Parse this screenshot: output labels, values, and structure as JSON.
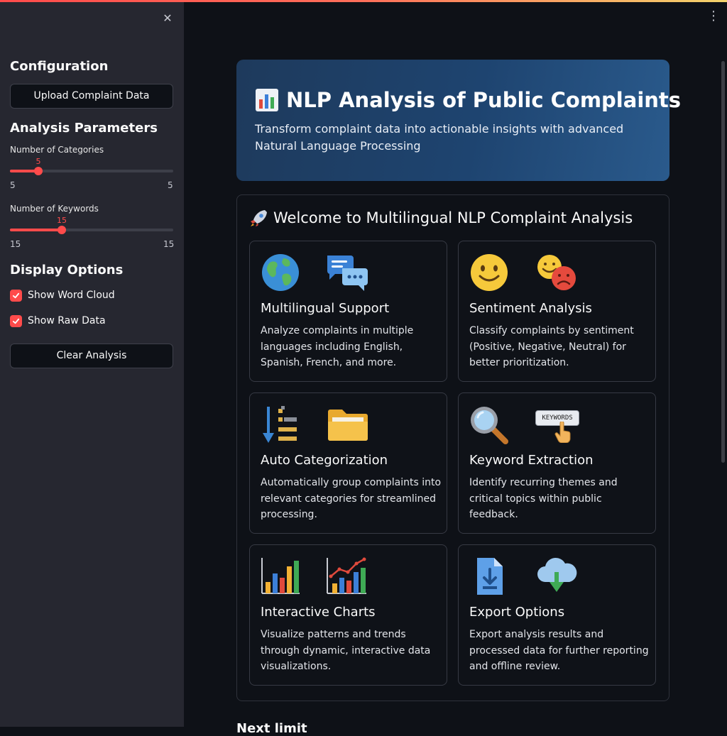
{
  "sidebar": {
    "configuration_heading": "Configuration",
    "upload_button": "Upload Complaint Data",
    "analysis_heading": "Analysis Parameters",
    "categories": {
      "label": "Number of Categories",
      "value": "5",
      "min": "5",
      "max": "5"
    },
    "keywords": {
      "label": "Number of Keywords",
      "value": "15",
      "min": "15",
      "max": "15"
    },
    "display_heading": "Display Options",
    "show_word_cloud": "Show Word Cloud",
    "show_raw_data": "Show Raw Data",
    "clear_button": "Clear Analysis"
  },
  "hero": {
    "title": "NLP Analysis of Public Complaints",
    "subtitle": "Transform complaint data into actionable insights with advanced Natural Language Processing"
  },
  "welcome": {
    "title": "Welcome to Multilingual NLP Complaint Analysis"
  },
  "cards": [
    {
      "title": "Multilingual Support",
      "desc": "Analyze complaints in multiple languages including English, Spanish, French, and more."
    },
    {
      "title": "Sentiment Analysis",
      "desc": "Classify complaints by sentiment (Positive, Negative, Neutral) for better prioritization."
    },
    {
      "title": "Auto Categorization",
      "desc": "Automatically group complaints into relevant categories for streamlined processing."
    },
    {
      "title": "Keyword Extraction",
      "desc": "Identify recurring themes and critical topics within public feedback.",
      "badge": "KEYWORDS"
    },
    {
      "title": "Interactive Charts",
      "desc": "Visualize patterns and trends through dynamic, interactive data visualizations."
    },
    {
      "title": "Export Options",
      "desc": "Export analysis results and processed data for further reporting and offline review."
    }
  ],
  "below_text": "Next limit",
  "colors": {
    "accent": "#ff4b4b",
    "sidebar_bg": "#262730",
    "main_bg": "#0e1117",
    "hero_bg": "#1e4470"
  }
}
